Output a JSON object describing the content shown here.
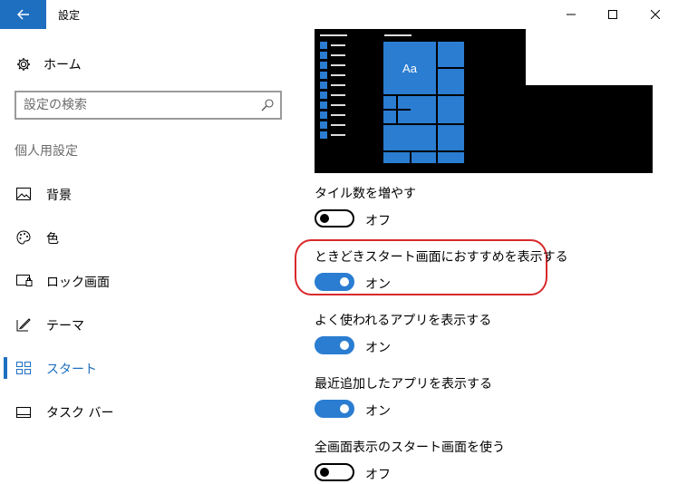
{
  "window": {
    "title": "設定"
  },
  "sidebar": {
    "home_label": "ホーム",
    "search_placeholder": "設定の検索",
    "section_label": "個人用設定",
    "items": [
      {
        "label": "背景",
        "icon": "picture-icon"
      },
      {
        "label": "色",
        "icon": "palette-icon"
      },
      {
        "label": "ロック画面",
        "icon": "lock-screen-icon"
      },
      {
        "label": "テーマ",
        "icon": "theme-icon"
      },
      {
        "label": "スタート",
        "icon": "start-icon",
        "active": true
      },
      {
        "label": "タスク バー",
        "icon": "taskbar-icon"
      }
    ]
  },
  "preview": {
    "tile_text": "Aa"
  },
  "settings": [
    {
      "label": "タイル数を増やす",
      "state": "オフ",
      "on": false
    },
    {
      "label": "ときどきスタート画面におすすめを表示する",
      "state": "オン",
      "on": true
    },
    {
      "label": "よく使われるアプリを表示する",
      "state": "オン",
      "on": true
    },
    {
      "label": "最近追加したアプリを表示する",
      "state": "オン",
      "on": true
    },
    {
      "label": "全画面表示のスタート画面を使う",
      "state": "オフ",
      "on": false
    }
  ],
  "colors": {
    "accent": "#1f6fc0",
    "toggle_on": "#2a7dd1",
    "highlight": "#d9292c"
  }
}
